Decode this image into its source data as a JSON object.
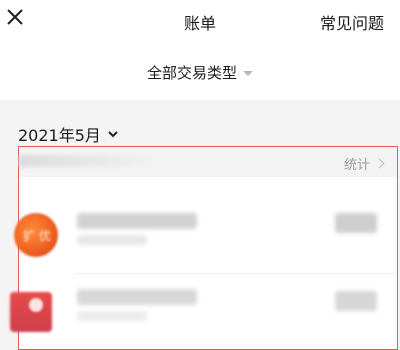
{
  "header": {
    "title": "账单",
    "faq_label": "常见问题"
  },
  "filter": {
    "label": "全部交易类型"
  },
  "month": {
    "label": "2021年5月"
  },
  "summary": {
    "stats_label": "统计"
  },
  "avatars": {
    "first_text": "扩 优"
  },
  "icons": {
    "close": "close-icon",
    "filter_caret": "caret-down-icon",
    "month_chevron": "chevron-down-icon",
    "stats_chevron": "chevron-right-icon"
  },
  "colors": {
    "highlight_border": "#e25a5a",
    "avatar_orange": "#f07a2c",
    "avatar_red": "#e04848"
  }
}
